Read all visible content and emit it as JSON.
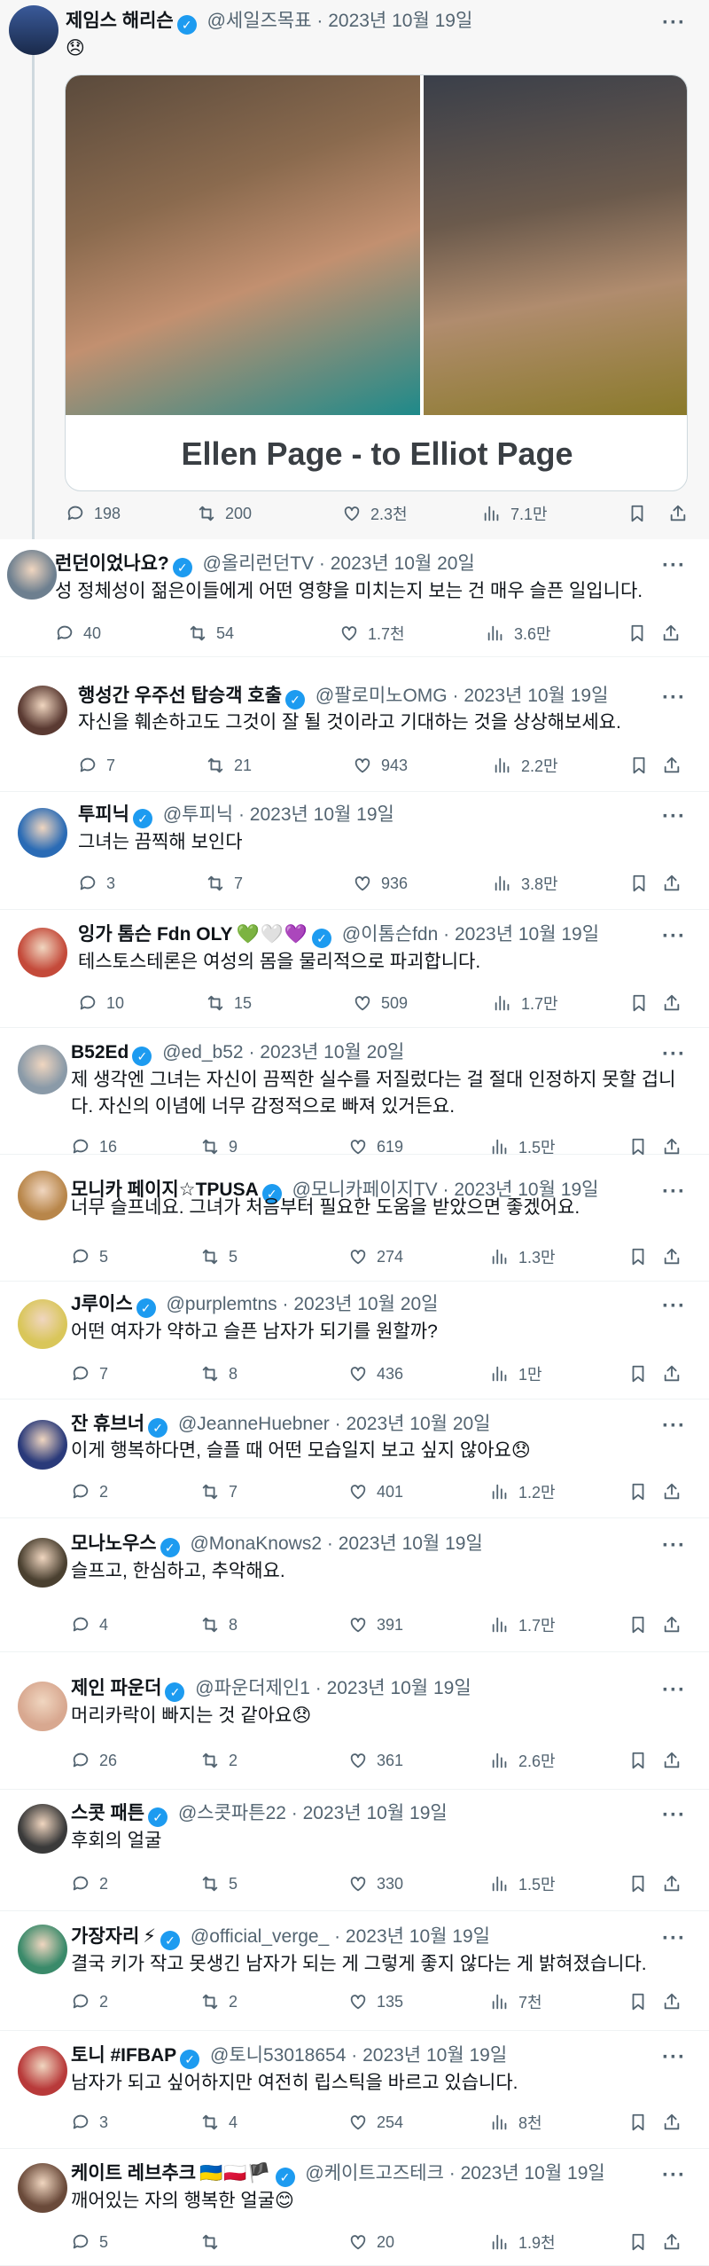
{
  "main_tweet": {
    "name": "제임스 해리슨",
    "handle": "@세일즈목표",
    "date": "2023년 10월 19일",
    "text": "😞",
    "card_title": "Ellen Page - to Elliot Page",
    "stats": {
      "replies": "198",
      "retweets": "200",
      "likes": "2.3천",
      "views": "7.1만"
    }
  },
  "replies": [
    {
      "name": "런던이었나요?",
      "handle": "@올리런던TV",
      "date": "2023년 10월 20일",
      "text": [
        "성 정체성이 젊은이들에게 어떤 영향을 미치는지 보는 건 매우 슬픈 일입니다."
      ],
      "replies": "40",
      "retweets": "54",
      "likes": "1.7천",
      "views": "3.6만",
      "avatar_color": "#6d7f8f"
    },
    {
      "name": "행성간 우주선 탑승객 호출",
      "handle": "@팔로미노OMG",
      "date": "2023년 10월 19일",
      "text": [
        "자신을 훼손하고도 그것이 잘 될 것이라고 기대하는 것을 상상해보세요."
      ],
      "replies": "7",
      "retweets": "21",
      "likes": "943",
      "views": "2.2만",
      "avatar_color": "#5a3a32"
    },
    {
      "name": "투피닉",
      "handle": "@투피닉",
      "date": "2023년 10월 19일",
      "text": [
        "그녀는 끔찍해 보인다"
      ],
      "replies": "3",
      "retweets": "7",
      "likes": "936",
      "views": "3.8만",
      "avatar_color": "#2a6bb5"
    },
    {
      "name": "잉가 톰슨 Fdn OLY",
      "emojis": "💚🤍💜",
      "handle": "@이톰슨fdn",
      "date": "2023년 10월 19일",
      "text": [
        "테스토스테론은 여성의 몸을 물리적으로 파괴합니다."
      ],
      "replies": "10",
      "retweets": "15",
      "likes": "509",
      "views": "1.7만",
      "avatar_color": "#c44a3a"
    },
    {
      "name": "B52Ed",
      "handle": "@ed_b52",
      "date": "2023년 10월 20일",
      "text": [
        "제 생각엔 그녀는 자신이 끔찍한 실수를 저질렀다는 걸 절대 인정하지 못할 겁니",
        "다. 자신의 이념에 너무 감정적으로 빠져 있거든요."
      ],
      "replies": "16",
      "retweets": "9",
      "likes": "619",
      "views": "1.5만",
      "avatar_color": "#8a9aa8"
    },
    {
      "name": "모니카 페이지☆TPUSA",
      "handle": "@모니카페이지TV",
      "date": "2023년 10월 19일",
      "text": [
        "너무 슬프네요. 그녀가 처음부터 필요한 도움을 받았으면 좋겠어요."
      ],
      "replies": "5",
      "retweets": "5",
      "likes": "274",
      "views": "1.3만",
      "avatar_color": "#b8864a"
    },
    {
      "name": "J루이스",
      "handle": "@purplemtns",
      "date": "2023년 10월 20일",
      "text": [
        "어떤 여자가 약하고 슬픈 남자가 되기를 원할까?"
      ],
      "replies": "7",
      "retweets": "8",
      "likes": "436",
      "views": "1만",
      "avatar_color": "#d9c65a"
    },
    {
      "name": "잔 휴브너",
      "handle": "@JeanneHuebner",
      "date": "2023년 10월 20일",
      "text": [
        "이게 행복하다면, 슬플 때 어떤 모습일지 보고 싶지 않아요😞"
      ],
      "replies": "2",
      "retweets": "7",
      "likes": "401",
      "views": "1.2만",
      "avatar_color": "#2a3a7a"
    },
    {
      "name": "모나노우스",
      "handle": "@MonaKnows2",
      "date": "2023년 10월 19일",
      "text": [
        "슬프고, 한심하고, 추악해요."
      ],
      "replies": "4",
      "retweets": "8",
      "likes": "391",
      "views": "1.7만",
      "avatar_color": "#4a4030"
    },
    {
      "name": "제인 파운더",
      "handle": "@파운더제인1",
      "date": "2023년 10월 19일",
      "text": [
        "머리카락이 빠지는 것 같아요😞"
      ],
      "replies": "26",
      "retweets": "2",
      "likes": "361",
      "views": "2.6만",
      "avatar_color": "#d8a890"
    },
    {
      "name": "스콧 패튼",
      "handle": "@스콧파튼22",
      "date": "2023년 10월 19일",
      "text": [
        "후회의 얼굴"
      ],
      "replies": "2",
      "retweets": "5",
      "likes": "330",
      "views": "1.5만",
      "avatar_color": "#3a3a3a"
    },
    {
      "name": "가장자리",
      "emojis": "⚡",
      "handle": "@official_verge_",
      "date": "2023년 10월 19일",
      "text": [
        "결국 키가 작고 못생긴 남자가 되는 게 그렇게 좋지 않다는 게 밝혀졌습니다."
      ],
      "replies": "2",
      "retweets": "2",
      "likes": "135",
      "views": "7천",
      "avatar_color": "#3a8a6a"
    },
    {
      "name": "토니 #IFBAP",
      "handle": "@토니53018654",
      "date": "2023년 10월 19일",
      "text": [
        "남자가 되고 싶어하지만 여전히 립스틱을 바르고 있습니다."
      ],
      "replies": "3",
      "retweets": "4",
      "likes": "254",
      "views": "8천",
      "avatar_color": "#b83a3a"
    },
    {
      "name": "케이트 레브추크",
      "emojis": "🇺🇦🇵🇱🏴",
      "handle": "@케이트고즈테크",
      "date": "2023년 10월 19일",
      "text": [
        "깨어있는 자의 행복한 얼굴😊"
      ],
      "replies": "5",
      "retweets": "",
      "likes": "20",
      "views": "1.9천",
      "avatar_color": "#6a4a3a"
    }
  ]
}
